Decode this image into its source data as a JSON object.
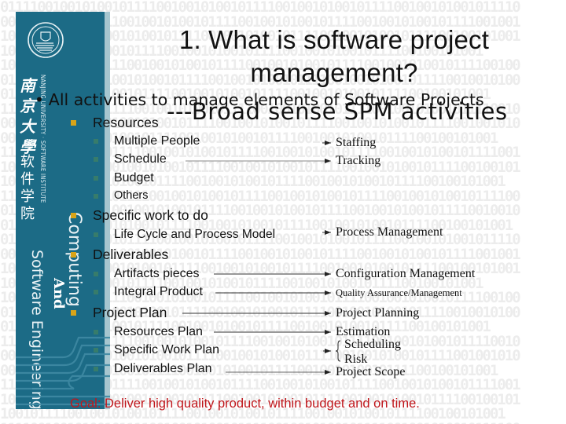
{
  "slide": {
    "title_line1": "1. What is software project",
    "title_line2": "management?",
    "subtitle": "---Broad sense SPM activities",
    "lead_bullet": "All activities to manage elements of Software Projects",
    "goal": "Goal: Deliver high quality product, within budget and on time."
  },
  "sidebar": {
    "cn_name": "南京大學",
    "cn_school": "软件学院",
    "en_name": "NANJING UNIVERSITY · SOFTWARE INSTITUTE",
    "computing": "Computing",
    "and": "And",
    "software_engineering": "Software Engineering",
    "logo": "university-seal-icon"
  },
  "elements": [
    {
      "label": "Resources",
      "children": [
        {
          "label": "Multiple People"
        },
        {
          "label": "Schedule"
        },
        {
          "label": "Budget"
        },
        {
          "label": "Others"
        }
      ]
    },
    {
      "label": "Specific work to do",
      "children": [
        {
          "label": "Life Cycle and Process Model"
        }
      ]
    },
    {
      "label": "Deliverables",
      "children": [
        {
          "label": "Artifacts pieces"
        },
        {
          "label": "Integral Product"
        }
      ]
    },
    {
      "label": "Project Plan",
      "children": [
        {
          "label": "Resources Plan"
        },
        {
          "label": "Specific Work Plan"
        },
        {
          "label": "Deliverables Plan"
        }
      ]
    }
  ],
  "activities": [
    {
      "label": "Staffing"
    },
    {
      "label": "Tracking"
    },
    {
      "label": "Process Management"
    },
    {
      "label": "Configuration Management"
    },
    {
      "label": "Quality Assurance/Management"
    },
    {
      "label": "Project Planning"
    },
    {
      "label": "Estimation"
    },
    {
      "label": "Scheduling"
    },
    {
      "label": "Risk"
    },
    {
      "label": "Project Scope"
    }
  ],
  "colors": {
    "sidebar": "#1c6b86",
    "sidebar_strip": "#a6c6cf",
    "bullet_level1": "#d9a417",
    "goal_text": "#c0161b"
  }
}
